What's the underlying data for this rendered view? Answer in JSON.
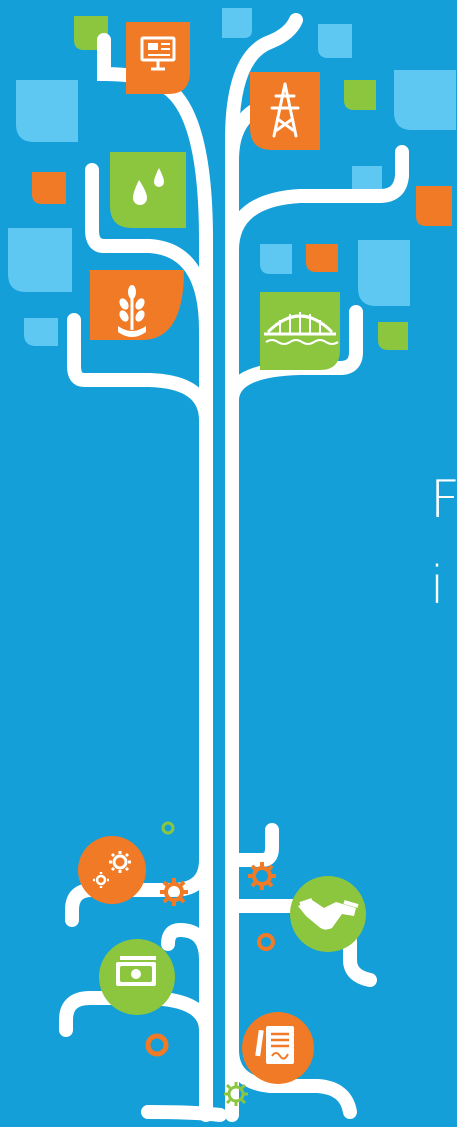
{
  "headline": {
    "line1": "F",
    "line2": "i"
  },
  "colors": {
    "background": "#159fd8",
    "branch": "#ffffff",
    "orange": "#f07a26",
    "green": "#8cc63f",
    "light_blue": "#5ec8f2"
  },
  "icons": {
    "leaves": [
      "computer-monitor-icon",
      "power-tower-icon",
      "water-drops-icon",
      "wheat-icon",
      "bridge-icon"
    ],
    "roots": [
      "gears-icon",
      "handshake-icon",
      "money-icon",
      "document-signature-icon"
    ]
  }
}
